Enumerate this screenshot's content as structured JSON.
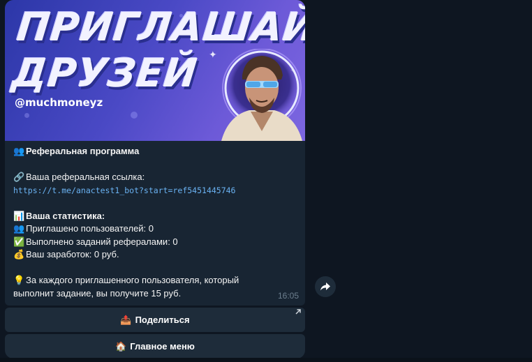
{
  "banner": {
    "title_line1": "ПРИГЛАШАЙ",
    "title_line2": "ДРУЗЕЙ",
    "handle": "@muchmoneyz"
  },
  "message": {
    "heading_emoji": "👥",
    "heading": "Реферальная программа",
    "link_label_emoji": "🔗",
    "link_label": "Ваша реферальная ссылка:",
    "link_url": "https://t.me/anactest1_bot?start=ref5451445746",
    "stats_emoji": "📊",
    "stats_heading": "Ваша статистика:",
    "invited_emoji": "👥",
    "invited": "Приглашено пользователей: 0",
    "completed_emoji": "✅",
    "completed": "Выполнено заданий рефералами: 0",
    "earnings_emoji": "💰",
    "earnings": "Ваш заработок: 0 руб.",
    "tip_emoji": "💡",
    "tip_line1": "За каждого приглашенного пользователя, который",
    "tip_line2": "выполнит задание, вы получите 15 руб.",
    "time": "16:05"
  },
  "keyboard": {
    "share_emoji": "📤",
    "share_label": "Поделиться",
    "menu_emoji": "🏠",
    "menu_label": "Главное меню"
  },
  "icons": {
    "forward": "forward-arrow-icon",
    "external": "external-link-arrow-icon"
  },
  "colors": {
    "background": "#0e1621",
    "bubble": "#182533",
    "button": "#1e2c3a",
    "link": "#6ab2f2",
    "time": "#6d7f8f"
  }
}
